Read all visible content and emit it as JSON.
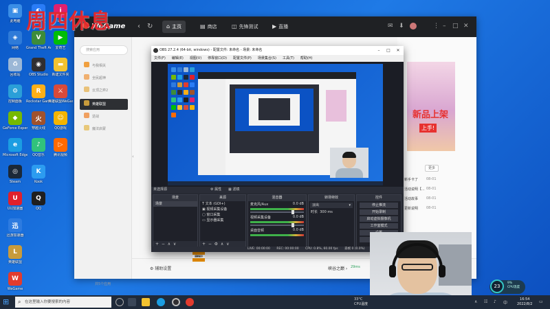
{
  "overlay_title": "周四休息",
  "desktop_icons": [
    {
      "label": "此电脑",
      "color": "#3a8ee6",
      "glyph": "▣",
      "icon": "computer-icon"
    },
    {
      "label": "网络",
      "color": "#2f7bd8",
      "glyph": "◈",
      "icon": "network-icon"
    },
    {
      "label": "回收站",
      "color": "#9bb7d6",
      "glyph": "♻",
      "icon": "recycle-bin-icon"
    },
    {
      "label": "控制面板",
      "color": "#2a9fd8",
      "glyph": "⚙",
      "icon": "control-panel-icon"
    },
    {
      "label": "GeForce Experience",
      "color": "#76b900",
      "glyph": "◆",
      "icon": "geforce-icon"
    },
    {
      "label": "Microsoft Edge",
      "color": "#1b9de2",
      "glyph": "e",
      "icon": "edge-icon"
    },
    {
      "label": "Steam",
      "color": "#1b2838",
      "glyph": "◎",
      "icon": "steam-icon"
    },
    {
      "label": "UU加速器",
      "color": "#e0202c",
      "glyph": "U",
      "icon": "uu-icon"
    },
    {
      "label": "迅游加速器",
      "color": "#2d7be0",
      "glyph": "迅",
      "icon": "xunyou-icon"
    },
    {
      "label": "英雄联盟",
      "color": "#c89b3c",
      "glyph": "L",
      "icon": "lol-icon"
    },
    {
      "label": "WeGame",
      "color": "#e23b2e",
      "glyph": "W",
      "icon": "wegame-icon"
    },
    {
      "label": "腾讯会议",
      "color": "#2a7cf6",
      "glyph": "◐",
      "icon": "tencent-meeting-icon"
    },
    {
      "label": "Grand Theft Auto V",
      "color": "#3d8c3a",
      "glyph": "V",
      "icon": "gta-icon"
    },
    {
      "label": "OBS Studio",
      "color": "#302e31",
      "glyph": "◉",
      "icon": "obs-icon"
    },
    {
      "label": "Rockstar Games",
      "color": "#fcaf17",
      "glyph": "R",
      "icon": "rockstar-icon"
    },
    {
      "label": "穿越火线",
      "color": "#a0522d",
      "glyph": "火",
      "icon": "cf-icon"
    },
    {
      "label": "QQ音乐",
      "color": "#31c27c",
      "glyph": "♪",
      "icon": "qq-music-icon"
    },
    {
      "label": "Kook",
      "color": "#2c9cf0",
      "glyph": "K",
      "icon": "kook-icon"
    },
    {
      "label": "QQ",
      "color": "#1f1f1f",
      "glyph": "Q",
      "icon": "qq-icon"
    },
    {
      "label": "iam",
      "color": "#e0206e",
      "glyph": "i",
      "icon": "iam-icon"
    },
    {
      "label": "爱奇艺",
      "color": "#00be06",
      "glyph": "▶",
      "icon": "iqiyi-icon"
    },
    {
      "label": "新建文件夹",
      "color": "#f2c230",
      "glyph": "▬",
      "icon": "folder-icon"
    },
    {
      "label": "英雄联盟WeGame版",
      "color": "#d84a3a",
      "glyph": "⚔",
      "icon": "lol-wegame-icon"
    },
    {
      "label": "QQ游戏",
      "color": "#f4b400",
      "glyph": "☺",
      "icon": "qq-game-icon"
    },
    {
      "label": "腾讯视频",
      "color": "#ff6a00",
      "glyph": "▷",
      "icon": "tencent-video-icon"
    }
  ],
  "wegame": {
    "logo": "WeGame",
    "tabs": [
      {
        "label": "主页",
        "icon": "home-icon",
        "glyph": "⌂",
        "active": true
      },
      {
        "label": "商店",
        "icon": "store-icon",
        "glyph": "▤",
        "active": false
      },
      {
        "label": "先锋测试",
        "icon": "test-icon",
        "glyph": "◫",
        "active": false
      },
      {
        "label": "直播",
        "icon": "live-icon",
        "glyph": "▶",
        "active": false
      }
    ],
    "search_placeholder": "搜索应用",
    "sidebar": [
      {
        "label": "与我相关",
        "color": "#f0a040",
        "active": false
      },
      {
        "label": "全民超神",
        "color": "#f0b070",
        "active": false
      },
      {
        "label": "云顶之弈2",
        "color": "#e9c27a",
        "active": false
      },
      {
        "label": "英雄联盟",
        "color": "#c89b3c",
        "active": true
      },
      {
        "label": "逆战",
        "color": "#f0a060",
        "active": false
      },
      {
        "label": "魔法启蒙",
        "color": "#e8c87a",
        "active": false
      }
    ],
    "sidebar_footer": "共5个应用",
    "aux_settings": "辅助设置",
    "rating_label": "16+",
    "rating_sub": "适龄提示",
    "game_name": "峡谷之巅",
    "score": "29ms",
    "banner_text": "新品上架",
    "banner_badge": "上手!",
    "more_label": "更多",
    "news": [
      {
        "title": "新手卡了",
        "date": "08-01"
      },
      {
        "title": "活动说明【...",
        "date": "08-01"
      },
      {
        "title": "活动故事",
        "date": "08-01"
      },
      {
        "title": "更新说明",
        "date": "08-01"
      }
    ]
  },
  "obs": {
    "title": "OBS 27.2.4 (64-bit, windows) - 配置文件: 未命名 - 场景: 未命名",
    "menu": [
      "文件(F)",
      "编辑(E)",
      "视图(V)",
      "停靠窗口(D)",
      "配置文件(P)",
      "场景集合(S)",
      "工具(T)",
      "帮助(H)"
    ],
    "no_source": "未选择源",
    "properties": "属性",
    "filters": "滤镜",
    "docks": {
      "scenes": {
        "title": "场景",
        "items": [
          "场景"
        ]
      },
      "sources": {
        "title": "来源",
        "items": [
          "文本 (GDI+)",
          "视频采集设备",
          "窗口采集",
          "显示器采集"
        ]
      },
      "mixer": {
        "title": "混音器",
        "channels": [
          {
            "name": "麦克风/Aux",
            "db": "0.0 dB"
          },
          {
            "name": "视频采集设备",
            "db": "0.0 dB"
          },
          {
            "name": "桌面音频",
            "db": "0.0 dB"
          }
        ]
      },
      "transitions": {
        "title": "转场特效",
        "type": "淡出",
        "duration_label": "时长",
        "duration": "300 ms"
      },
      "controls": {
        "title": "控件",
        "buttons": [
          "停止推流",
          "开始录制",
          "启动虚拟摄像机",
          "工作室模式",
          "设置",
          "退出"
        ]
      }
    },
    "status": {
      "live": "LIVE: 00:00:00",
      "rec": "REC: 00:00:00",
      "cpu": "CPU: 0.8%, 60.00 fps",
      "dropped": "丢帧 0 (0.0%)",
      "kbps": "kb/s: 0"
    }
  },
  "gauge": {
    "value": "23",
    "unit": "%",
    "line1": "9%",
    "line2": "CPU温度"
  },
  "taskbar": {
    "search_placeholder": "在这里输入你要搜索的内容",
    "weather_temp": "33°C",
    "weather_desc": "CPU温度",
    "time": "16:54",
    "date": "2022/8/2"
  }
}
